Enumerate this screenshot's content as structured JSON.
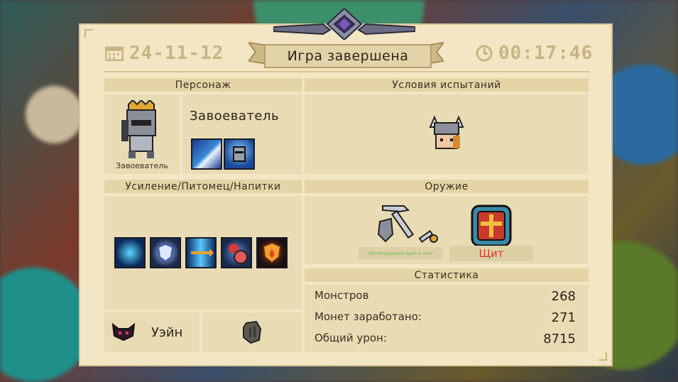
{
  "header": {
    "date": "24-11-12",
    "time": "00:17:46",
    "title": "Игра завершена"
  },
  "character": {
    "section_label": "Персонаж",
    "name": "Завоеватель",
    "portrait_caption": "Завоеватель",
    "skills": [
      "whirlwind-skill-icon",
      "knight-helmet-skill-icon"
    ]
  },
  "challenge": {
    "section_label": "Условия испытаний",
    "icon": "viking-helmet-icon"
  },
  "buffs": {
    "section_label": "Усиление/Питомец/Напитки",
    "items": [
      "sparkle-buff-icon",
      "shield-buff-icon",
      "arrow-buff-icon",
      "potion-buff-icon",
      "fire-shield-buff-icon"
    ]
  },
  "pet": {
    "name": "Уэйн",
    "icon": "pet-face-icon",
    "drink_icon": "stone-drink-icon"
  },
  "weapons": {
    "section_label": "Оружие",
    "items": [
      {
        "name": "Легендарный щит и меч",
        "color": "#6fbf5a"
      },
      {
        "name": "Щит",
        "color": "#d23a2a"
      }
    ]
  },
  "stats": {
    "section_label": "Статистика",
    "rows": [
      {
        "label": "Монстров",
        "value": "268"
      },
      {
        "label": "Монет заработано:",
        "value": "271"
      },
      {
        "label": "Общий урон:",
        "value": "8715"
      }
    ]
  },
  "colors": {
    "panel": "#f2e6c4",
    "header_band": "#e4d4a6",
    "muted_text": "#c9b483"
  }
}
